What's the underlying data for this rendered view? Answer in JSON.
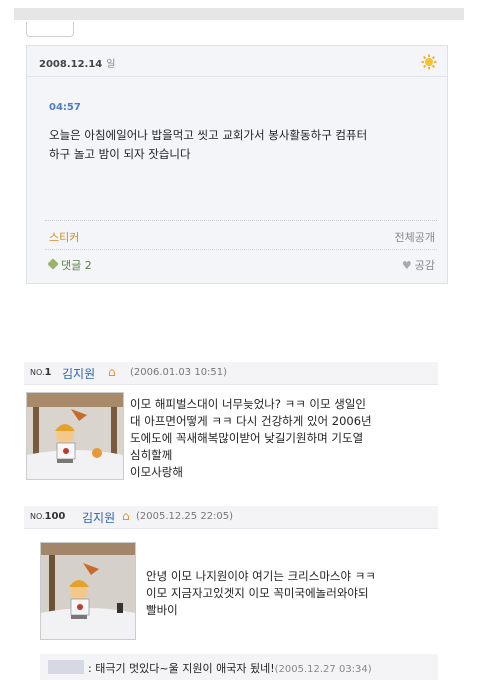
{
  "diary": {
    "date": "2008.12.14",
    "day": "일",
    "weather_icon": "sun-icon",
    "time": "04:57",
    "body_line1": "오늘은 아침에일어나 밥을먹고 씻고 교회가서 봉사활동하구 컴퓨터",
    "body_line2": "하구 놀고 밤이 되자 잣습니다",
    "sticker_label": "스티커",
    "visibility": "전체공개",
    "comment_label": "댓글",
    "comment_count": "2",
    "like_label": "공감"
  },
  "guestbook": [
    {
      "no_prefix": "NO.",
      "no": "1",
      "name": "김지원",
      "timestamp": "(2006.01.03 10:51)",
      "lines": [
        "이모 해피벌스대이 너무늦었나? ㅋㅋ 이모 생일인",
        "대 아프면어떻게 ㅋㅋ 다시 건강하게 있어 2006년",
        "도에도에 꼭새해복많이받어 낮길기원하며 기도열",
        "심히할께",
        "이모사랑해"
      ]
    },
    {
      "no_prefix": "NO.",
      "no": "100",
      "name": "김지원",
      "timestamp": "(2005.12.25 22:05)",
      "lines": [
        "안녕 이모 나지원이야 여기는 크리스마스야 ㅋㅋ",
        "이모 지금자고있겟지 이모 꼭미국에놀러와야되",
        "빨바이"
      ]
    }
  ],
  "reply": {
    "text": ": 태극기 멋있다~울 지원이 애국자 됬네!",
    "timestamp": "(2005.12.27 03:34)"
  }
}
